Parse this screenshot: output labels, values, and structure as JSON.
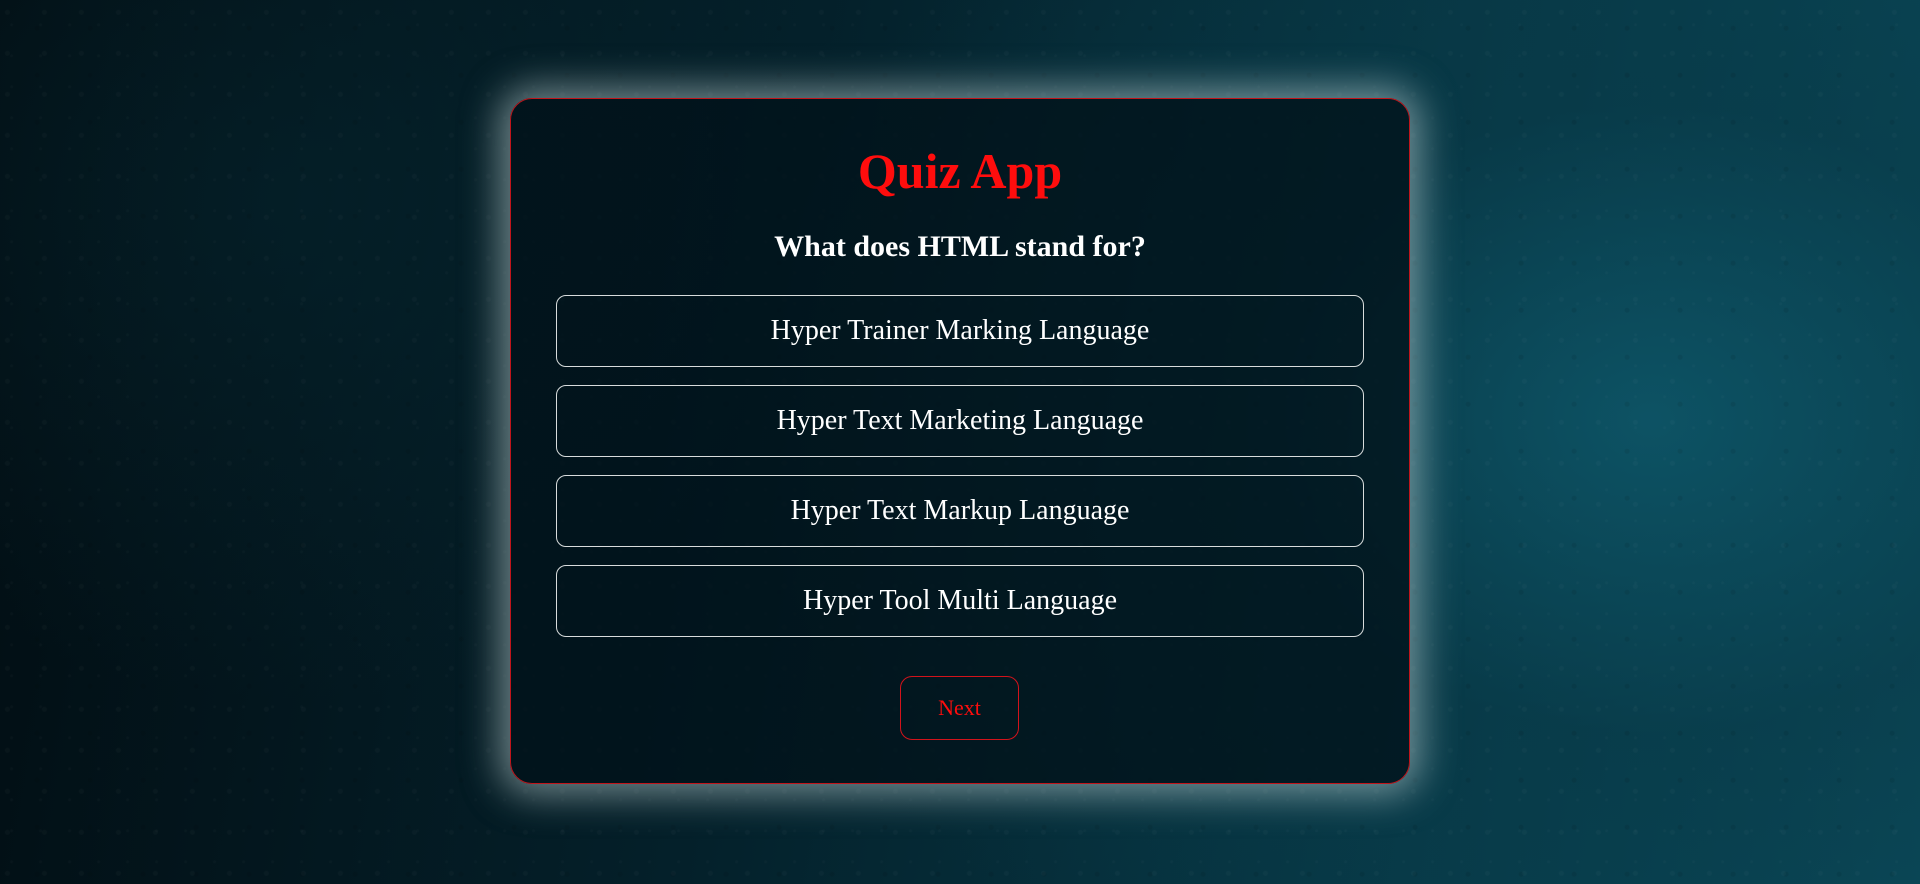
{
  "app": {
    "title": "Quiz App"
  },
  "quiz": {
    "question": "What does HTML stand for?",
    "answers": [
      {
        "label": "Hyper Trainer Marking Language"
      },
      {
        "label": "Hyper Text Marketing Language"
      },
      {
        "label": "Hyper Text Markup Language"
      },
      {
        "label": "Hyper Tool Multi Language"
      }
    ],
    "next_label": "Next"
  },
  "colors": {
    "accent": "#ff0d0d",
    "text": "#ffffff",
    "card_border": "#c0151b"
  }
}
